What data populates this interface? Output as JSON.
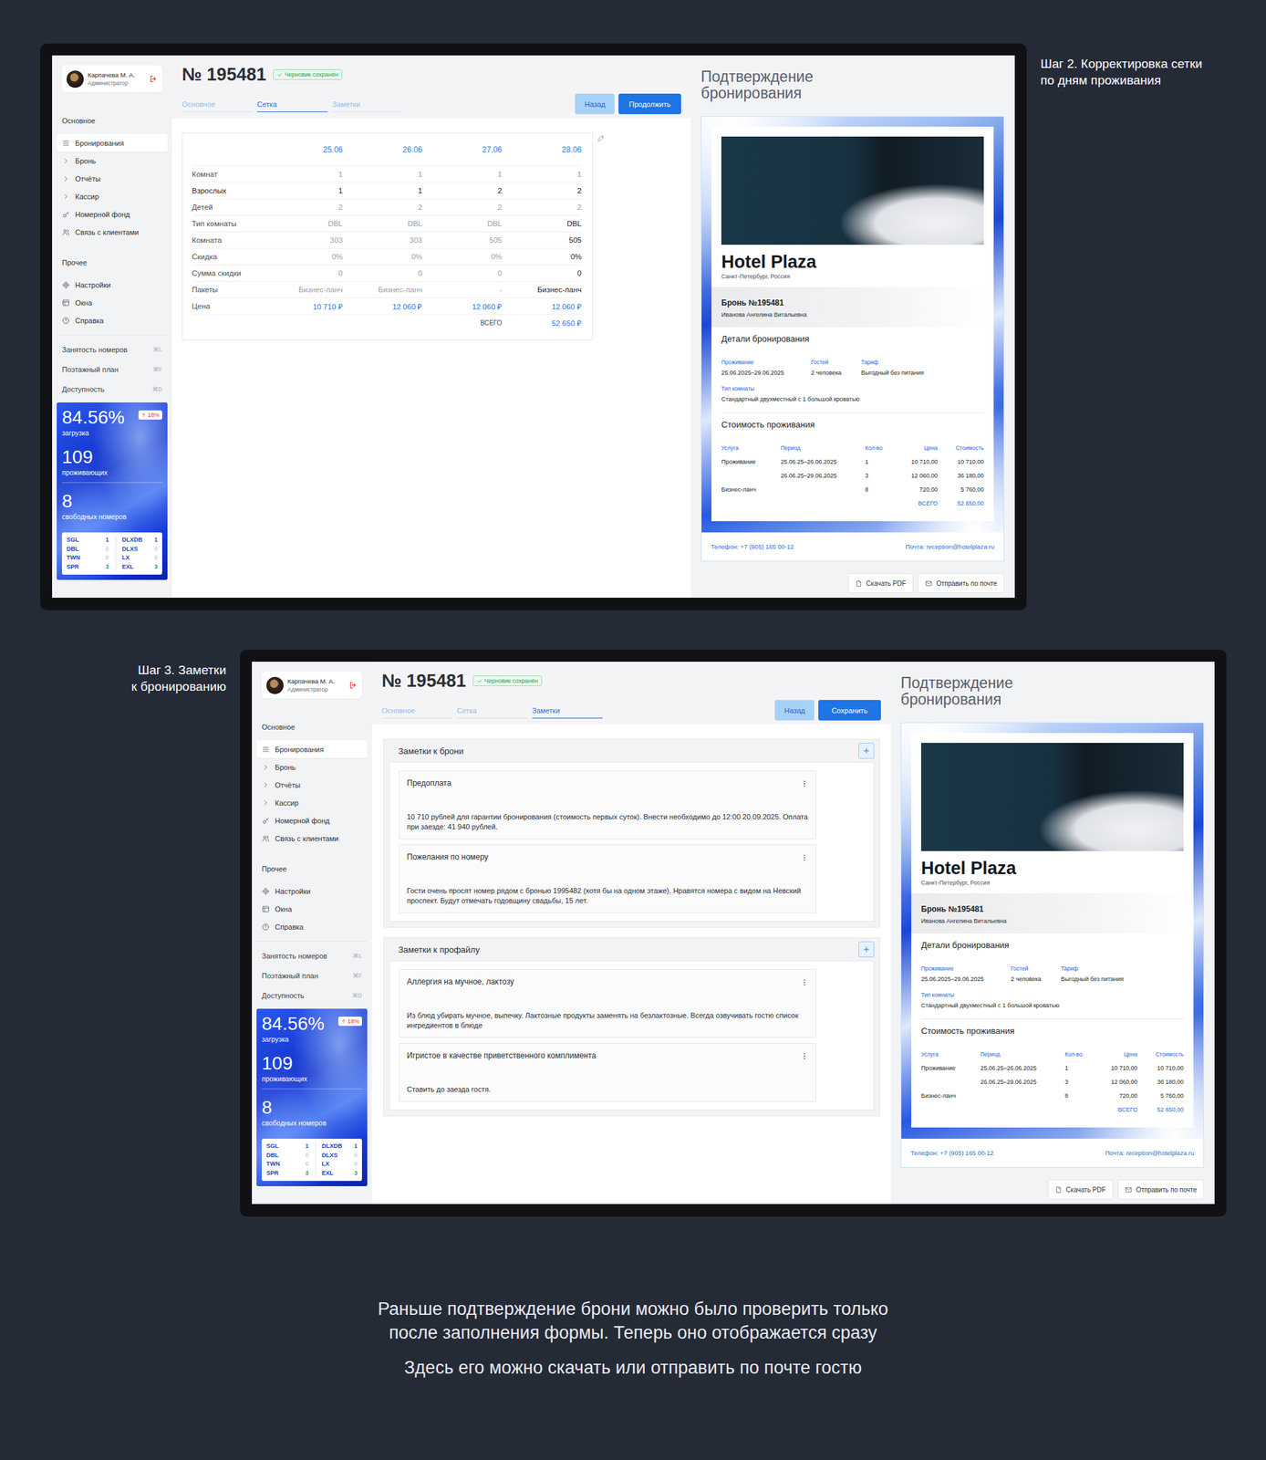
{
  "screens": [
    {
      "caption": [
        "Шаг 2. Корректировка сетки",
        "по дням проживания"
      ],
      "booking_number": "№ 195481",
      "draft_badge": "Черновик сохранён",
      "tabs": [
        {
          "label": "Основное",
          "selected": false
        },
        {
          "label": "Сетка",
          "selected": true
        },
        {
          "label": "Заметки",
          "selected": false
        }
      ],
      "buttons": [
        {
          "label": "Назад",
          "primary": false
        },
        {
          "label": "Продолжить",
          "primary": true
        }
      ],
      "content": {
        "kind": "grid",
        "columns": [
          "25.06",
          "26.06",
          "27.06",
          "28.06"
        ],
        "rows": [
          {
            "label": "Комнат",
            "emphasized": false,
            "kind": "value",
            "cells": [
              {
                "text": "1",
                "emphasized": false
              },
              {
                "text": "1",
                "emphasized": false
              },
              {
                "text": "1",
                "emphasized": false
              },
              {
                "text": "1",
                "emphasized": false
              }
            ]
          },
          {
            "label": "Взрослых",
            "emphasized": true,
            "kind": "value",
            "cells": [
              {
                "text": "1",
                "emphasized": true
              },
              {
                "text": "1",
                "emphasized": true
              },
              {
                "text": "2",
                "emphasized": true
              },
              {
                "text": "2",
                "emphasized": true
              }
            ]
          },
          {
            "label": "Детей",
            "emphasized": false,
            "kind": "value",
            "cells": [
              {
                "text": "2",
                "emphasized": false
              },
              {
                "text": "2",
                "emphasized": false
              },
              {
                "text": "2",
                "emphasized": false
              },
              {
                "text": "2",
                "emphasized": false
              }
            ]
          },
          {
            "label": "Тип комнаты",
            "emphasized": false,
            "kind": "value",
            "cells": [
              {
                "text": "DBL",
                "emphasized": false
              },
              {
                "text": "DBL",
                "emphasized": false
              },
              {
                "text": "DBL",
                "emphasized": false
              },
              {
                "text": "DBL",
                "emphasized": true
              }
            ]
          },
          {
            "label": "Комната",
            "emphasized": false,
            "kind": "value",
            "cells": [
              {
                "text": "303",
                "emphasized": false
              },
              {
                "text": "303",
                "emphasized": false
              },
              {
                "text": "505",
                "emphasized": false
              },
              {
                "text": "505",
                "emphasized": true
              }
            ]
          },
          {
            "label": "Скидка",
            "emphasized": false,
            "kind": "value",
            "cells": [
              {
                "text": "0%",
                "emphasized": false
              },
              {
                "text": "0%",
                "emphasized": false
              },
              {
                "text": "0%",
                "emphasized": false
              },
              {
                "text": "0%",
                "emphasized": true
              }
            ]
          },
          {
            "label": "Сумма скидки",
            "emphasized": false,
            "kind": "value",
            "cells": [
              {
                "text": "0",
                "emphasized": false
              },
              {
                "text": "0",
                "emphasized": false
              },
              {
                "text": "0",
                "emphasized": false
              },
              {
                "text": "0",
                "emphasized": true
              }
            ]
          },
          {
            "label": "Пакеты",
            "emphasized": false,
            "kind": "value",
            "cells": [
              {
                "text": "Бизнес-ланч",
                "emphasized": false
              },
              {
                "text": "Бизнес-ланч",
                "emphasized": false
              },
              {
                "text": "-",
                "emphasized": false
              },
              {
                "text": "Бизнес-ланч",
                "emphasized": true
              }
            ]
          },
          {
            "label": "Цена",
            "emphasized": false,
            "kind": "price",
            "cells": [
              {
                "text": "10 710 ₽",
                "emphasized": false
              },
              {
                "text": "12 060 ₽",
                "emphasized": false
              },
              {
                "text": "12 060 ₽",
                "emphasized": false
              },
              {
                "text": "12 060 ₽",
                "emphasized": false
              }
            ]
          }
        ],
        "total": {
          "label": "ВСЕГО",
          "value": "52 650 ₽"
        }
      }
    },
    {
      "caption": [
        "Шаг 3. Заметки",
        "к бронированию"
      ],
      "booking_number": "№ 195481",
      "draft_badge": "Черновик сохранён",
      "tabs": [
        {
          "label": "Основное",
          "selected": false
        },
        {
          "label": "Сетка",
          "selected": false
        },
        {
          "label": "Заметки",
          "selected": true
        }
      ],
      "buttons": [
        {
          "label": "Назад",
          "primary": false
        },
        {
          "label": "Сохранить",
          "primary": true
        }
      ],
      "content": {
        "kind": "notes",
        "sections": [
          {
            "title": "Заметки к брони",
            "notes": [
              {
                "title": "Предоплата",
                "text": "10 710 рублей для гарантии бронирования (стоимость первых суток). Внести необходимо до 12:00 20.09.2025. Оплата при заезде: 41 940 рублей."
              },
              {
                "title": "Пожелания по номеру",
                "text": "Гости очень просят номер рядом с бронью 1995482 (хотя бы на одном этаже). Нравятся номера с видом на Невский проспект. Будут отмечать годовщину свадьбы, 15 лет."
              }
            ]
          },
          {
            "title": "Заметки к профайлу",
            "notes": [
              {
                "title": "Аллергия на мучное, лактозу",
                "text": "Из блюд убирать мучное, выпечку. Лактозные продукты заменять на безлактозные. Всегда озвучивать гостю список ингредиентов в блюде"
              },
              {
                "title": "Игристое в качестве приветственного комплимента",
                "text": "Ставить до заезда гостя."
              }
            ]
          }
        ]
      }
    }
  ],
  "sidebar": {
    "user": {
      "name": "Карпачева М. А.",
      "role": "Администратор"
    },
    "groups": [
      {
        "title": "Основное",
        "items": [
          {
            "label": "Бронирования",
            "selected": true,
            "expandable": false,
            "expanded": false
          },
          {
            "label": "Бронь",
            "selected": false,
            "expandable": true,
            "expanded": false
          },
          {
            "label": "Отчёты",
            "selected": false,
            "expandable": true,
            "expanded": false
          },
          {
            "label": "Кассир",
            "selected": false,
            "expandable": true,
            "expanded": false
          },
          {
            "label": "Номерной фонд",
            "selected": false,
            "expandable": false,
            "expanded": false
          },
          {
            "label": "Связь с клиентами",
            "selected": false,
            "expandable": false,
            "expanded": false
          }
        ]
      },
      {
        "title": "Прочее",
        "items": [
          {
            "label": "Настройки",
            "selected": false,
            "expandable": false,
            "expanded": false
          },
          {
            "label": "Окна",
            "selected": false,
            "expandable": false,
            "expanded": false
          },
          {
            "label": "Справка",
            "selected": false,
            "expandable": false,
            "expanded": false
          }
        ]
      }
    ],
    "shortcuts": [
      {
        "label": "Занятость номеров",
        "key": "⌘L"
      },
      {
        "label": "Поэтажный план",
        "key": "⌘F"
      },
      {
        "label": "Доступность",
        "key": "⌘D"
      }
    ],
    "stats": {
      "load": "84.56%",
      "load_label": "загрузка",
      "trend": "18%",
      "guests": "109",
      "guests_label": "проживающих",
      "free": "8",
      "free_label": "свободных номеров",
      "room_types": [
        {
          "code": "SGL",
          "count": "1",
          "color": "#1f56d8"
        },
        {
          "code": "DBL",
          "count": "0",
          "color": "#c9cfdc"
        },
        {
          "code": "TWN",
          "count": "0",
          "color": "#c9cfdc"
        },
        {
          "code": "SPR",
          "count": "3",
          "color": "#2e9e4f"
        },
        {
          "code": "DLXDB",
          "count": "1",
          "color": "#1f56d8"
        },
        {
          "code": "DLXS",
          "count": "0",
          "color": "#c9cfdc"
        },
        {
          "code": "LX",
          "count": "0",
          "color": "#c9cfdc"
        },
        {
          "code": "EXL",
          "count": "3",
          "color": "#2e9e4f"
        }
      ]
    }
  },
  "confirmation": {
    "title": "Подтверждение бронирования",
    "hotel": "Hotel Plaza",
    "city": "Санкт-Петербург, Россия",
    "booking": "Бронь №195481",
    "guest": "Иванова Ангелина Витальевна",
    "details_title": "Детали бронирования",
    "details": [
      {
        "label": "Проживание",
        "value": "25.06.2025–29.06.2025"
      },
      {
        "label": "Гостей",
        "value": "2 человека"
      },
      {
        "label": "Тариф",
        "value": "Выгодный без питания"
      },
      {
        "label": "Тип комнаты",
        "value": "Стандартный двухместный с 1 большой кроватью"
      }
    ],
    "cost_title": "Стоимость проживания",
    "cost_columns": [
      "Услуга",
      "Период",
      "Кол-во",
      "Цена",
      "Стоимость"
    ],
    "cost_rows": [
      [
        "Проживание",
        "25.06.25–26.06.2025",
        "1",
        "10 710,00",
        "10 710,00"
      ],
      [
        "",
        "26.06.25–29.06.2025",
        "3",
        "12 060,00",
        "36 180,00"
      ],
      [
        "Бизнес-ланч",
        "",
        "8",
        "720,00",
        "5 760,00"
      ]
    ],
    "total": {
      "label": "ВСЕГО",
      "value": "52 650,00"
    },
    "phone": "Телефон: +7 (905) 165 00-12",
    "email": "Почта: reception@hotelplaza.ru",
    "actions": [
      "Скачать PDF",
      "Отправить по почте"
    ]
  },
  "closing": [
    [
      "Раньше подтверждение брони можно было проверить только",
      "после заполнения формы. Теперь оно отображается сразу"
    ],
    [
      "Здесь его можно скачать или отправить по почте гостю"
    ]
  ]
}
